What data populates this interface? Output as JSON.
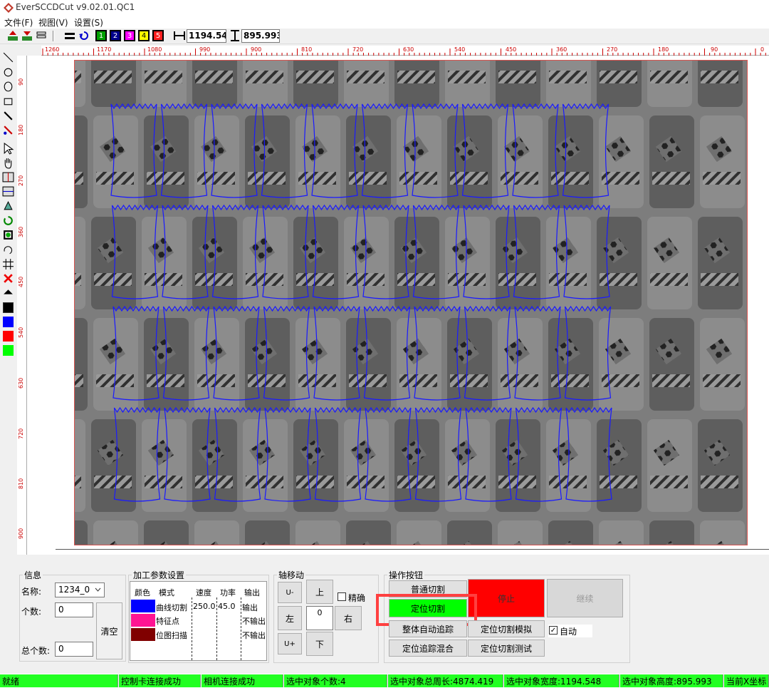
{
  "window": {
    "title": "EverSCCDCut v9.02.01.QC1"
  },
  "menu": [
    "文件(F)",
    "视图(V)",
    "设置(S)"
  ],
  "toolbar": {
    "width_value": "1194.548",
    "height_value": "895.993",
    "color_buttons": [
      "1",
      "2",
      "3",
      "4",
      "5"
    ]
  },
  "colors": {
    "blue": "#0000ff",
    "magenta": "#ff1493",
    "darkred": "#800000",
    "red": "#ff0000",
    "green": "#00ff00",
    "black": "#000000"
  },
  "ruler_top": [
    "1260",
    "1170",
    "1080",
    "990",
    "900",
    "810",
    "720",
    "630",
    "540",
    "450",
    "360",
    "270",
    "180",
    "90",
    "0"
  ],
  "ruler_left": [
    "90",
    "180",
    "270",
    "360",
    "450",
    "540",
    "630",
    "720",
    "810",
    "900"
  ],
  "info": {
    "title": "信息",
    "name_label": "名称:",
    "name_value": "1234_0",
    "count_label": "个数:",
    "count_value": "0",
    "total_label": "总个数:",
    "total_value": "0",
    "clear_label": "清空"
  },
  "params": {
    "title": "加工参数设置",
    "headers": [
      "颜色",
      "模式",
      "速度",
      "功率",
      "输出"
    ],
    "rows": [
      {
        "color": "#0000ff",
        "mode": "曲线切割",
        "speed": "250.0",
        "power": "45.0",
        "output": "输出"
      },
      {
        "color": "#ff1493",
        "mode": "特征点",
        "speed": "",
        "power": "",
        "output": "不输出"
      },
      {
        "color": "#800000",
        "mode": "位图扫描",
        "speed": "",
        "power": "",
        "output": "不输出"
      }
    ]
  },
  "axis": {
    "title": "轴移动",
    "u_minus": "U-",
    "up": "上",
    "precise_label": "精确",
    "left": "左",
    "step_value": "0",
    "right": "右",
    "u_plus": "U+",
    "down": "下"
  },
  "ops": {
    "title": "操作按钮",
    "normal_cut": "普通切割",
    "stop": "停止",
    "continue": "继续",
    "locate_cut": "定位切割",
    "whole_track": "整体自动追踪",
    "locate_sim": "定位切割模拟",
    "auto_label": "自动",
    "locate_mix": "定位追踪混合",
    "locate_test": "定位切割测试"
  },
  "status": [
    "就绪",
    "控制卡连接成功",
    "相机连接成功",
    "选中对象个数:4",
    "选中对象总周长:4874.419",
    "选中对象宽度:1194.548",
    "选中对象高度:895.993",
    "当前X坐标"
  ]
}
